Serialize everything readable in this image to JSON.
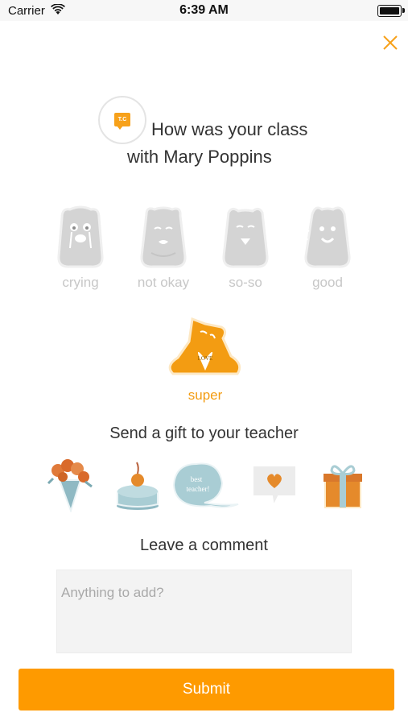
{
  "status_bar": {
    "carrier": "Carrier",
    "time": "6:39 AM"
  },
  "header": {
    "close_icon": "close-icon",
    "accent_color": "#f7a11a"
  },
  "teacher": {
    "avatar_text": "T.C",
    "question_line1": "How was your class",
    "question_line2": "with Mary Poppins"
  },
  "ratings": {
    "options": [
      {
        "label": "crying",
        "icon": "crying-bear-icon"
      },
      {
        "label": "not okay",
        "icon": "not-okay-bear-icon"
      },
      {
        "label": "so-so",
        "icon": "so-so-bear-icon"
      },
      {
        "label": "good",
        "icon": "good-bear-icon"
      }
    ],
    "selected": {
      "label": "super",
      "icon": "super-love-bear-icon",
      "heart_text": "LOVE"
    },
    "inactive_color": "#c7c7c7",
    "active_color": "#f39c12"
  },
  "gifts": {
    "title": "Send a gift to your teacher",
    "items": [
      {
        "icon": "flower-bouquet-icon"
      },
      {
        "icon": "cake-icon"
      },
      {
        "icon": "best-teacher-bubble-icon",
        "text_line1": "best",
        "text_line2": "teacher!"
      },
      {
        "icon": "heart-card-icon"
      },
      {
        "icon": "gift-box-icon"
      }
    ]
  },
  "comment": {
    "title": "Leave a comment",
    "placeholder": "Anything to add?",
    "value": ""
  },
  "submit": {
    "label": "Submit",
    "color": "#fe9a00"
  }
}
